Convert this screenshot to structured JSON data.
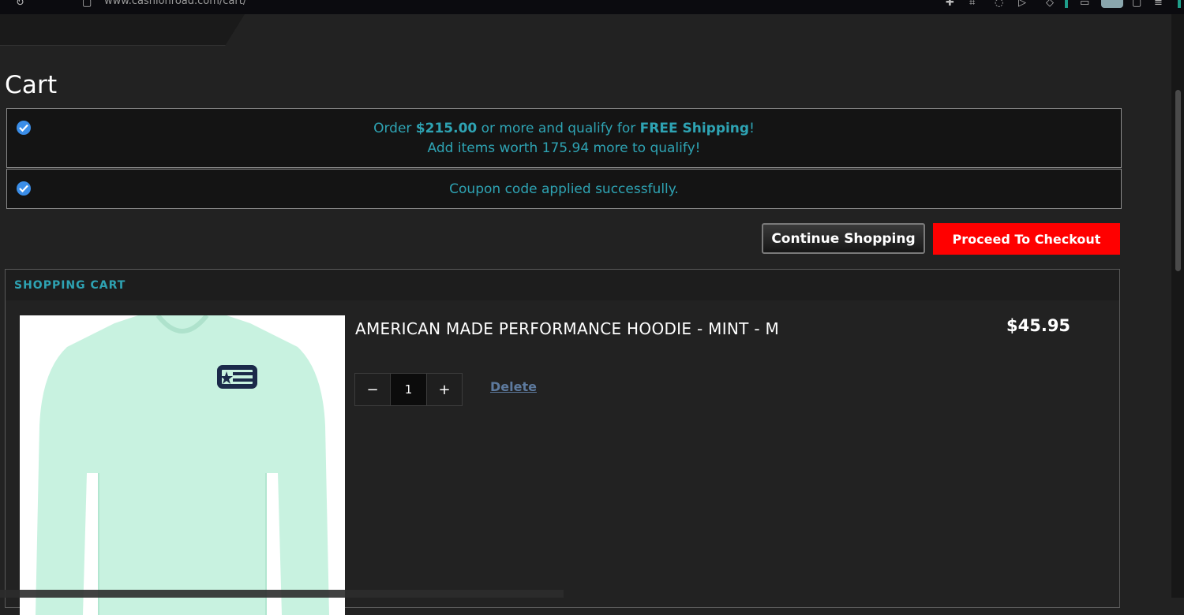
{
  "page": {
    "title": "Cart"
  },
  "browser": {
    "url": "www.cashionroad.com/cart/"
  },
  "notices": {
    "shipping": {
      "prefix": "Order ",
      "amount": "$215.00",
      "middle": " or more and qualify for ",
      "free": "FREE Shipping",
      "suffix": "!",
      "line2": "Add items worth 175.94 more to qualify!"
    },
    "coupon": {
      "message": "Coupon code applied successfully."
    }
  },
  "actions": {
    "continue_label": "Continue Shopping",
    "checkout_label": "Proceed To Checkout"
  },
  "cart": {
    "header": "SHOPPING CART",
    "items": [
      {
        "title": "AMERICAN MADE PERFORMANCE HOODIE - MINT - M",
        "price": "$45.95",
        "quantity": "1",
        "minus_label": "−",
        "plus_label": "+",
        "delete_label": "Delete"
      }
    ]
  },
  "colors": {
    "accent_teal": "#2ea3b3",
    "checkout_red": "#ff0000",
    "check_blue": "#3b8ee8",
    "hoodie_mint": "#c8f2e0",
    "logo_navy": "#1b2a4a"
  }
}
